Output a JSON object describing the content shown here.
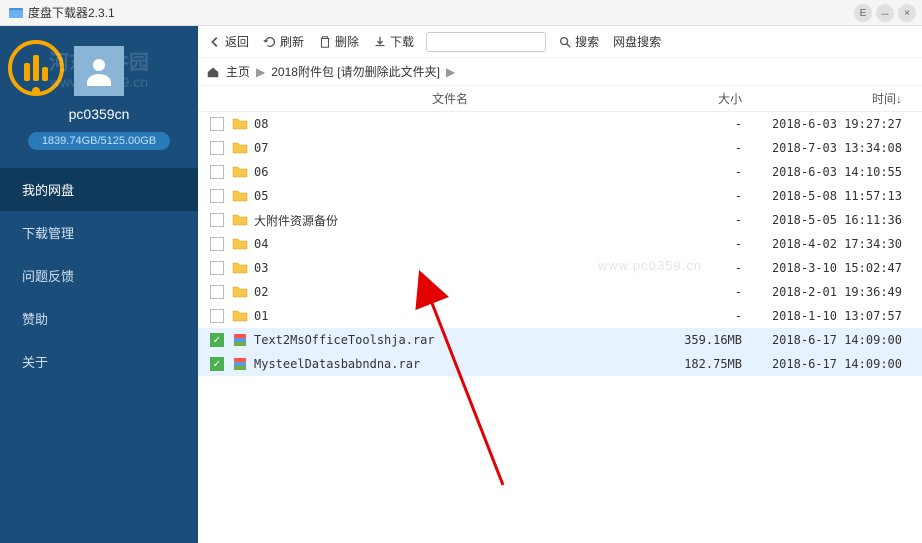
{
  "window": {
    "title": "度盘下载器2.3.1"
  },
  "watermark": {
    "brand": "河东软件园",
    "url": "www.pc0359.cn",
    "right": "www.pc0359.cn"
  },
  "user": {
    "name": "pc0359cn",
    "storage": "1839.74GB/5125.00GB"
  },
  "sidebar": {
    "items": [
      {
        "label": "我的网盘"
      },
      {
        "label": "下载管理"
      },
      {
        "label": "问题反馈"
      },
      {
        "label": "赞助"
      },
      {
        "label": "关于"
      }
    ]
  },
  "toolbar": {
    "back": "返回",
    "refresh": "刷新",
    "delete": "删除",
    "download": "下载",
    "search": "搜索",
    "pan_search": "网盘搜索"
  },
  "breadcrumb": {
    "home": "主页",
    "folder": "2018附件包 [请勿删除此文件夹]"
  },
  "headers": {
    "name": "文件名",
    "size": "大小",
    "time": "时间↓"
  },
  "files": [
    {
      "type": "folder",
      "name": "08",
      "size": "-",
      "time": "2018-6-03 19:27:27",
      "selected": false
    },
    {
      "type": "folder",
      "name": "07",
      "size": "-",
      "time": "2018-7-03 13:34:08",
      "selected": false
    },
    {
      "type": "folder",
      "name": "06",
      "size": "-",
      "time": "2018-6-03 14:10:55",
      "selected": false
    },
    {
      "type": "folder",
      "name": "05",
      "size": "-",
      "time": "2018-5-08 11:57:13",
      "selected": false
    },
    {
      "type": "folder",
      "name": "大附件资源备份",
      "size": "-",
      "time": "2018-5-05 16:11:36",
      "selected": false
    },
    {
      "type": "folder",
      "name": "04",
      "size": "-",
      "time": "2018-4-02 17:34:30",
      "selected": false
    },
    {
      "type": "folder",
      "name": "03",
      "size": "-",
      "time": "2018-3-10 15:02:47",
      "selected": false
    },
    {
      "type": "folder",
      "name": "02",
      "size": "-",
      "time": "2018-2-01 19:36:49",
      "selected": false
    },
    {
      "type": "folder",
      "name": "01",
      "size": "-",
      "time": "2018-1-10 13:07:57",
      "selected": false
    },
    {
      "type": "rar",
      "name": "Text2MsOfficeToolshja.rar",
      "size": "359.16MB",
      "time": "2018-6-17 14:09:00",
      "selected": true
    },
    {
      "type": "rar",
      "name": "MysteelDatasbabndna.rar",
      "size": "182.75MB",
      "time": "2018-6-17 14:09:00",
      "selected": true
    }
  ]
}
